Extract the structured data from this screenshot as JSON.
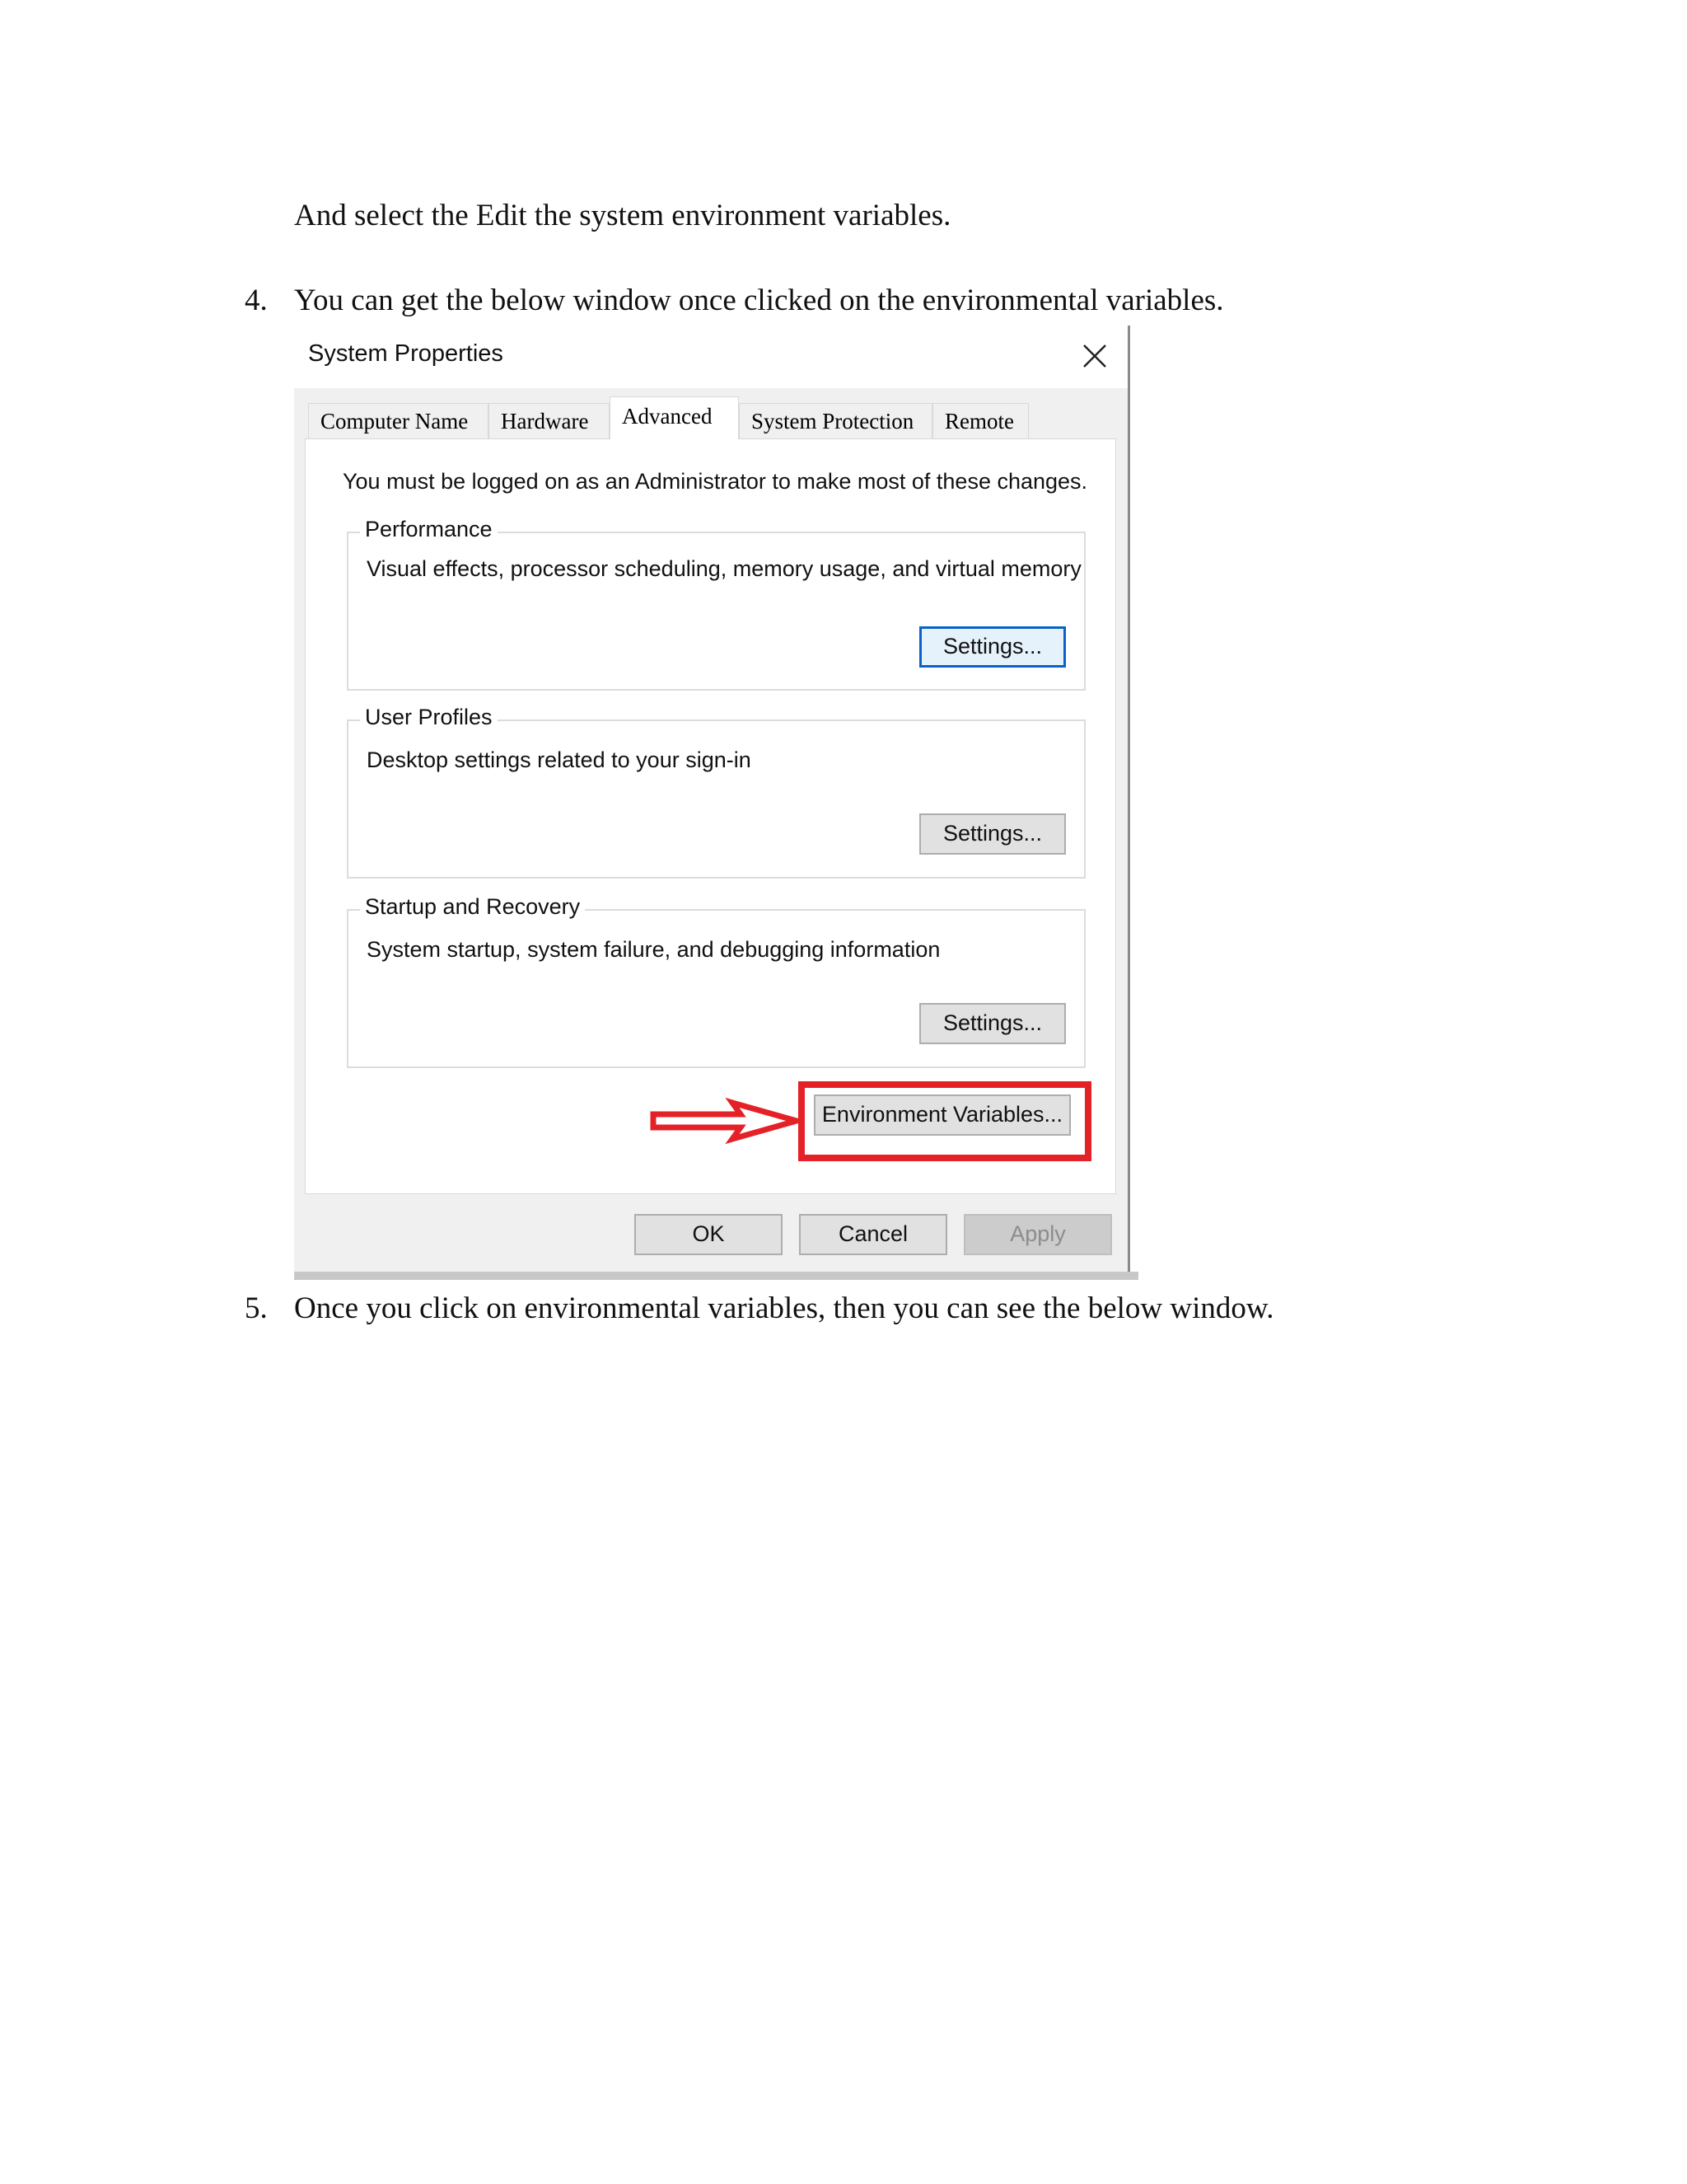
{
  "doc": {
    "intro_line": "And select the Edit the system environment variables.",
    "step4_num": "4.",
    "step4_text": "You can get the below window once clicked on the environmental variables.",
    "step5_num": "5.",
    "step5_text": "Once you click on environmental variables, then you can see the below window."
  },
  "dialog": {
    "title": "System Properties",
    "close_icon": "close-icon",
    "tabs": [
      {
        "label": "Computer Name"
      },
      {
        "label": "Hardware"
      },
      {
        "label": "Advanced"
      },
      {
        "label": "System Protection"
      },
      {
        "label": "Remote"
      }
    ],
    "active_tab": "Advanced",
    "admin_note": "You must be logged on as an Administrator to make most of these changes.",
    "groups": [
      {
        "legend": "Performance",
        "desc": "Visual effects, processor scheduling, memory usage, and virtual memory",
        "button": "Settings..."
      },
      {
        "legend": "User Profiles",
        "desc": "Desktop settings related to your sign-in",
        "button": "Settings..."
      },
      {
        "legend": "Startup and Recovery",
        "desc": "System startup, system failure, and debugging information",
        "button": "Settings..."
      }
    ],
    "env_button": "Environment Variables...",
    "footer": {
      "ok": "OK",
      "cancel": "Cancel",
      "apply": "Apply"
    },
    "annotation_color": "#e52128"
  }
}
